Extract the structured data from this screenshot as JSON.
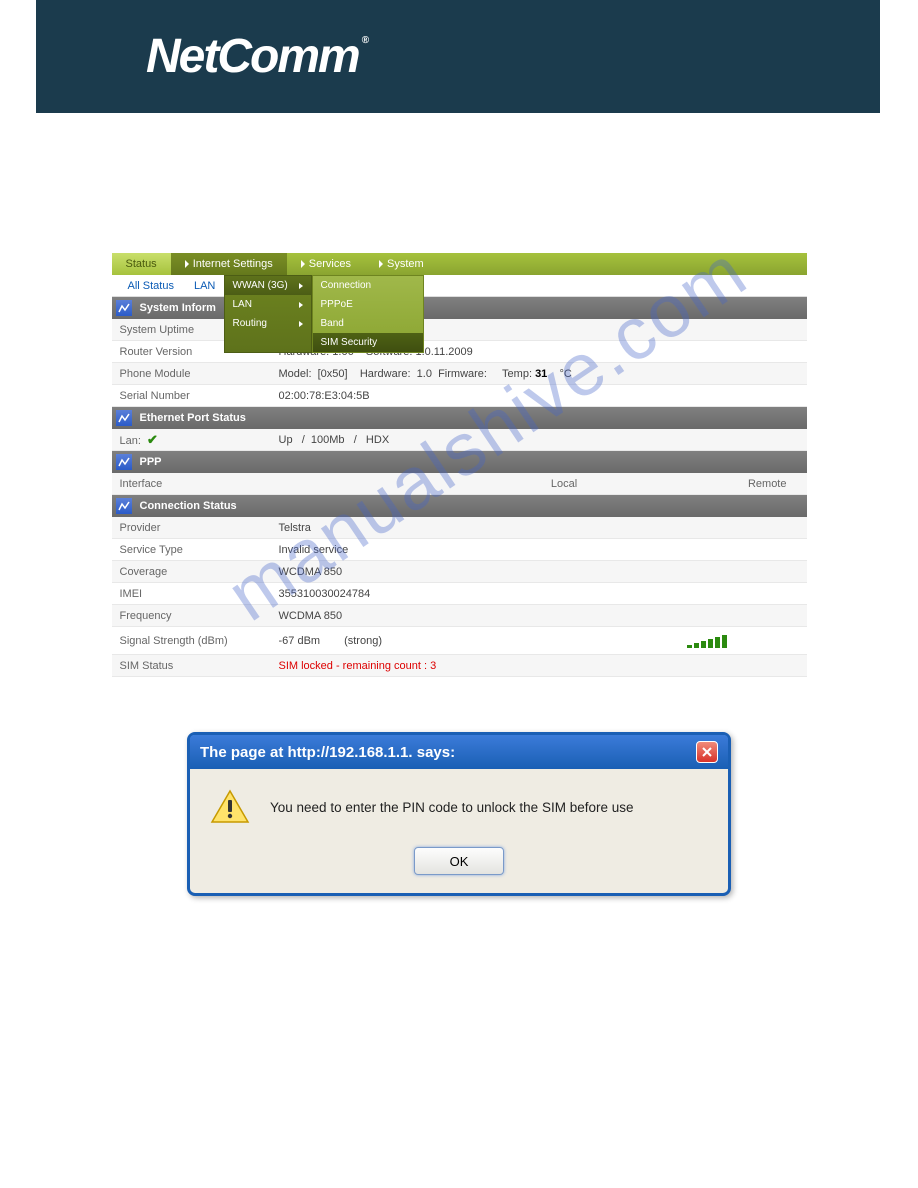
{
  "logo": "NetComm",
  "tabs": [
    "Status",
    "Internet Settings",
    "Services",
    "System"
  ],
  "subtabs": [
    "All Status",
    "LAN"
  ],
  "menu": {
    "col1": [
      {
        "label": "WWAN (3G)",
        "arrow": true,
        "active": true
      },
      {
        "label": "LAN",
        "arrow": true
      },
      {
        "label": "Routing",
        "arrow": true
      }
    ],
    "col2": [
      {
        "label": "Connection"
      },
      {
        "label": "PPPoE"
      },
      {
        "label": "Band"
      },
      {
        "label": "SIM Security",
        "selected": true
      }
    ]
  },
  "sections": {
    "sysinfo": {
      "title": "System Inform",
      "rows": [
        {
          "label": "System Uptime",
          "value": ""
        },
        {
          "label": "Router Version",
          "value": "Hardware: 1.06    Software: 1.0.11.2009"
        },
        {
          "label": "Phone Module",
          "value_pre": "Model:  [0x50]    Hardware:  1.0  Firmware:     Temp: ",
          "value_bold": "31",
          "value_post": "    °C"
        },
        {
          "label": "Serial Number",
          "value": "02:00:78:E3:04:5B"
        }
      ]
    },
    "eth": {
      "title": "Ethernet Port Status",
      "rows": [
        {
          "label": "Lan:",
          "check": true,
          "value": "Up   /  100Mb   /   HDX"
        }
      ]
    },
    "ppp": {
      "title": "PPP",
      "cols": [
        "Interface",
        "Local",
        "Remote"
      ]
    },
    "conn": {
      "title": "Connection Status",
      "rows": [
        {
          "label": "Provider",
          "value": "Telstra"
        },
        {
          "label": "Service Type",
          "value": "Invalid service"
        },
        {
          "label": "Coverage",
          "value": "WCDMA 850"
        },
        {
          "label": "IMEI",
          "value": "355310030024784"
        },
        {
          "label": "Frequency",
          "value": "WCDMA 850"
        },
        {
          "label": "Signal Strength (dBm)",
          "value_dbm": "-67 dBm",
          "value_str": "(strong)",
          "bars": 6
        },
        {
          "label": "SIM Status",
          "value_red": "SIM locked - remaining count : 3"
        }
      ]
    }
  },
  "dialog": {
    "title": "The page at http://192.168.1.1. says:",
    "message": "You need to enter the PIN code to unlock the SIM before use",
    "ok": "OK"
  },
  "watermark": "manualshive.com"
}
